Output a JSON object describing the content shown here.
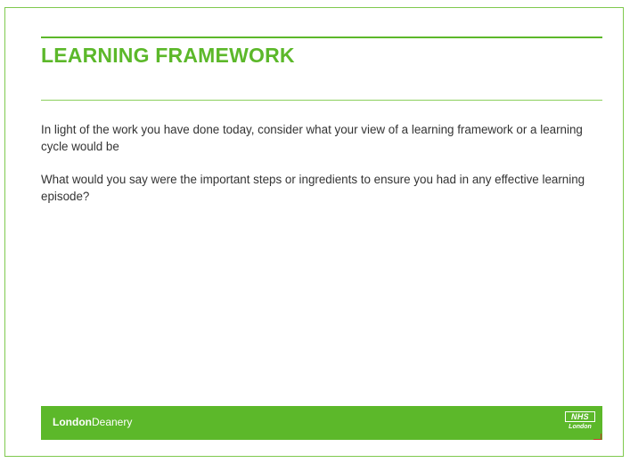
{
  "slide": {
    "title": "LEARNING FRAMEWORK",
    "paragraphs": [
      "In light of the work you have done today, consider what your view of a learning framework or a learning cycle would be",
      "What would you say were the important steps or ingredients to ensure you had in any effective learning episode?"
    ]
  },
  "footer": {
    "logo_bold": "London",
    "logo_regular": "Deanery",
    "nhs_badge": "NHS",
    "nhs_sub": "London"
  },
  "colors": {
    "accent_green": "#5cb82a",
    "text": "#333333",
    "background": "#ffffff"
  }
}
